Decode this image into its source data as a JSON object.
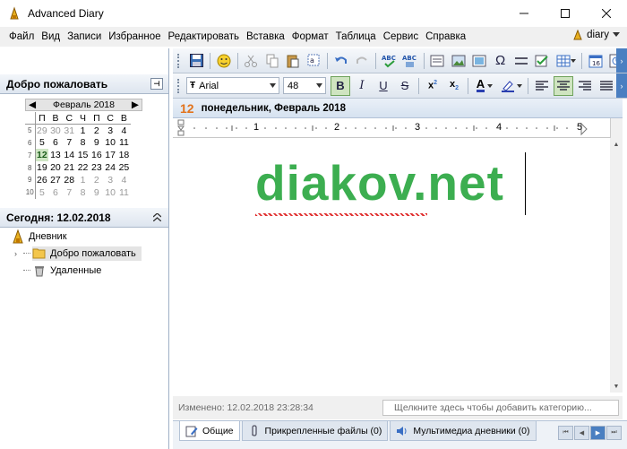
{
  "window": {
    "title": "Advanced Diary"
  },
  "menu": {
    "items": [
      "Файл",
      "Вид",
      "Записи",
      "Избранное",
      "Редактировать",
      "Вставка",
      "Формат",
      "Таблица",
      "Сервис",
      "Справка"
    ],
    "user": "diary"
  },
  "format_toolbar": {
    "font": "Arial",
    "size": "48"
  },
  "left_panel": {
    "title": "Добро пожаловать",
    "calendar": {
      "month": "Февраль 2018",
      "weekdays": [
        "П",
        "В",
        "С",
        "Ч",
        "П",
        "С",
        "В"
      ],
      "weeks": [
        {
          "n": "5",
          "days": [
            "29",
            "30",
            "31",
            "1",
            "2",
            "3",
            "4"
          ]
        },
        {
          "n": "6",
          "days": [
            "5",
            "6",
            "7",
            "8",
            "9",
            "10",
            "11"
          ]
        },
        {
          "n": "7",
          "days": [
            "12",
            "13",
            "14",
            "15",
            "16",
            "17",
            "18"
          ]
        },
        {
          "n": "8",
          "days": [
            "19",
            "20",
            "21",
            "22",
            "23",
            "24",
            "25"
          ]
        },
        {
          "n": "9",
          "days": [
            "26",
            "27",
            "28",
            "1",
            "2",
            "3",
            "4"
          ]
        },
        {
          "n": "10",
          "days": [
            "5",
            "6",
            "7",
            "8",
            "9",
            "10",
            "11"
          ]
        }
      ]
    },
    "today_label": "Сегодня: 12.02.2018",
    "tree": {
      "root": "Дневник",
      "welcome": "Добро пожаловать",
      "deleted": "Удаленные"
    }
  },
  "entry": {
    "day": "12",
    "date_text": "понедельник, Февраль 2018",
    "content": "diakov.net",
    "content_color": "#3cae50",
    "modified": "Изменено: 12.02.2018 23:28:34",
    "category_placeholder": "Щелкните здесь чтобы добавить категорию..."
  },
  "ruler": {
    "numbers": [
      "1",
      "2",
      "3",
      "4",
      "5"
    ]
  },
  "tabs": [
    "Общие",
    "Прикрепленные файлы (0)",
    "Мультимедиа дневники (0)"
  ]
}
